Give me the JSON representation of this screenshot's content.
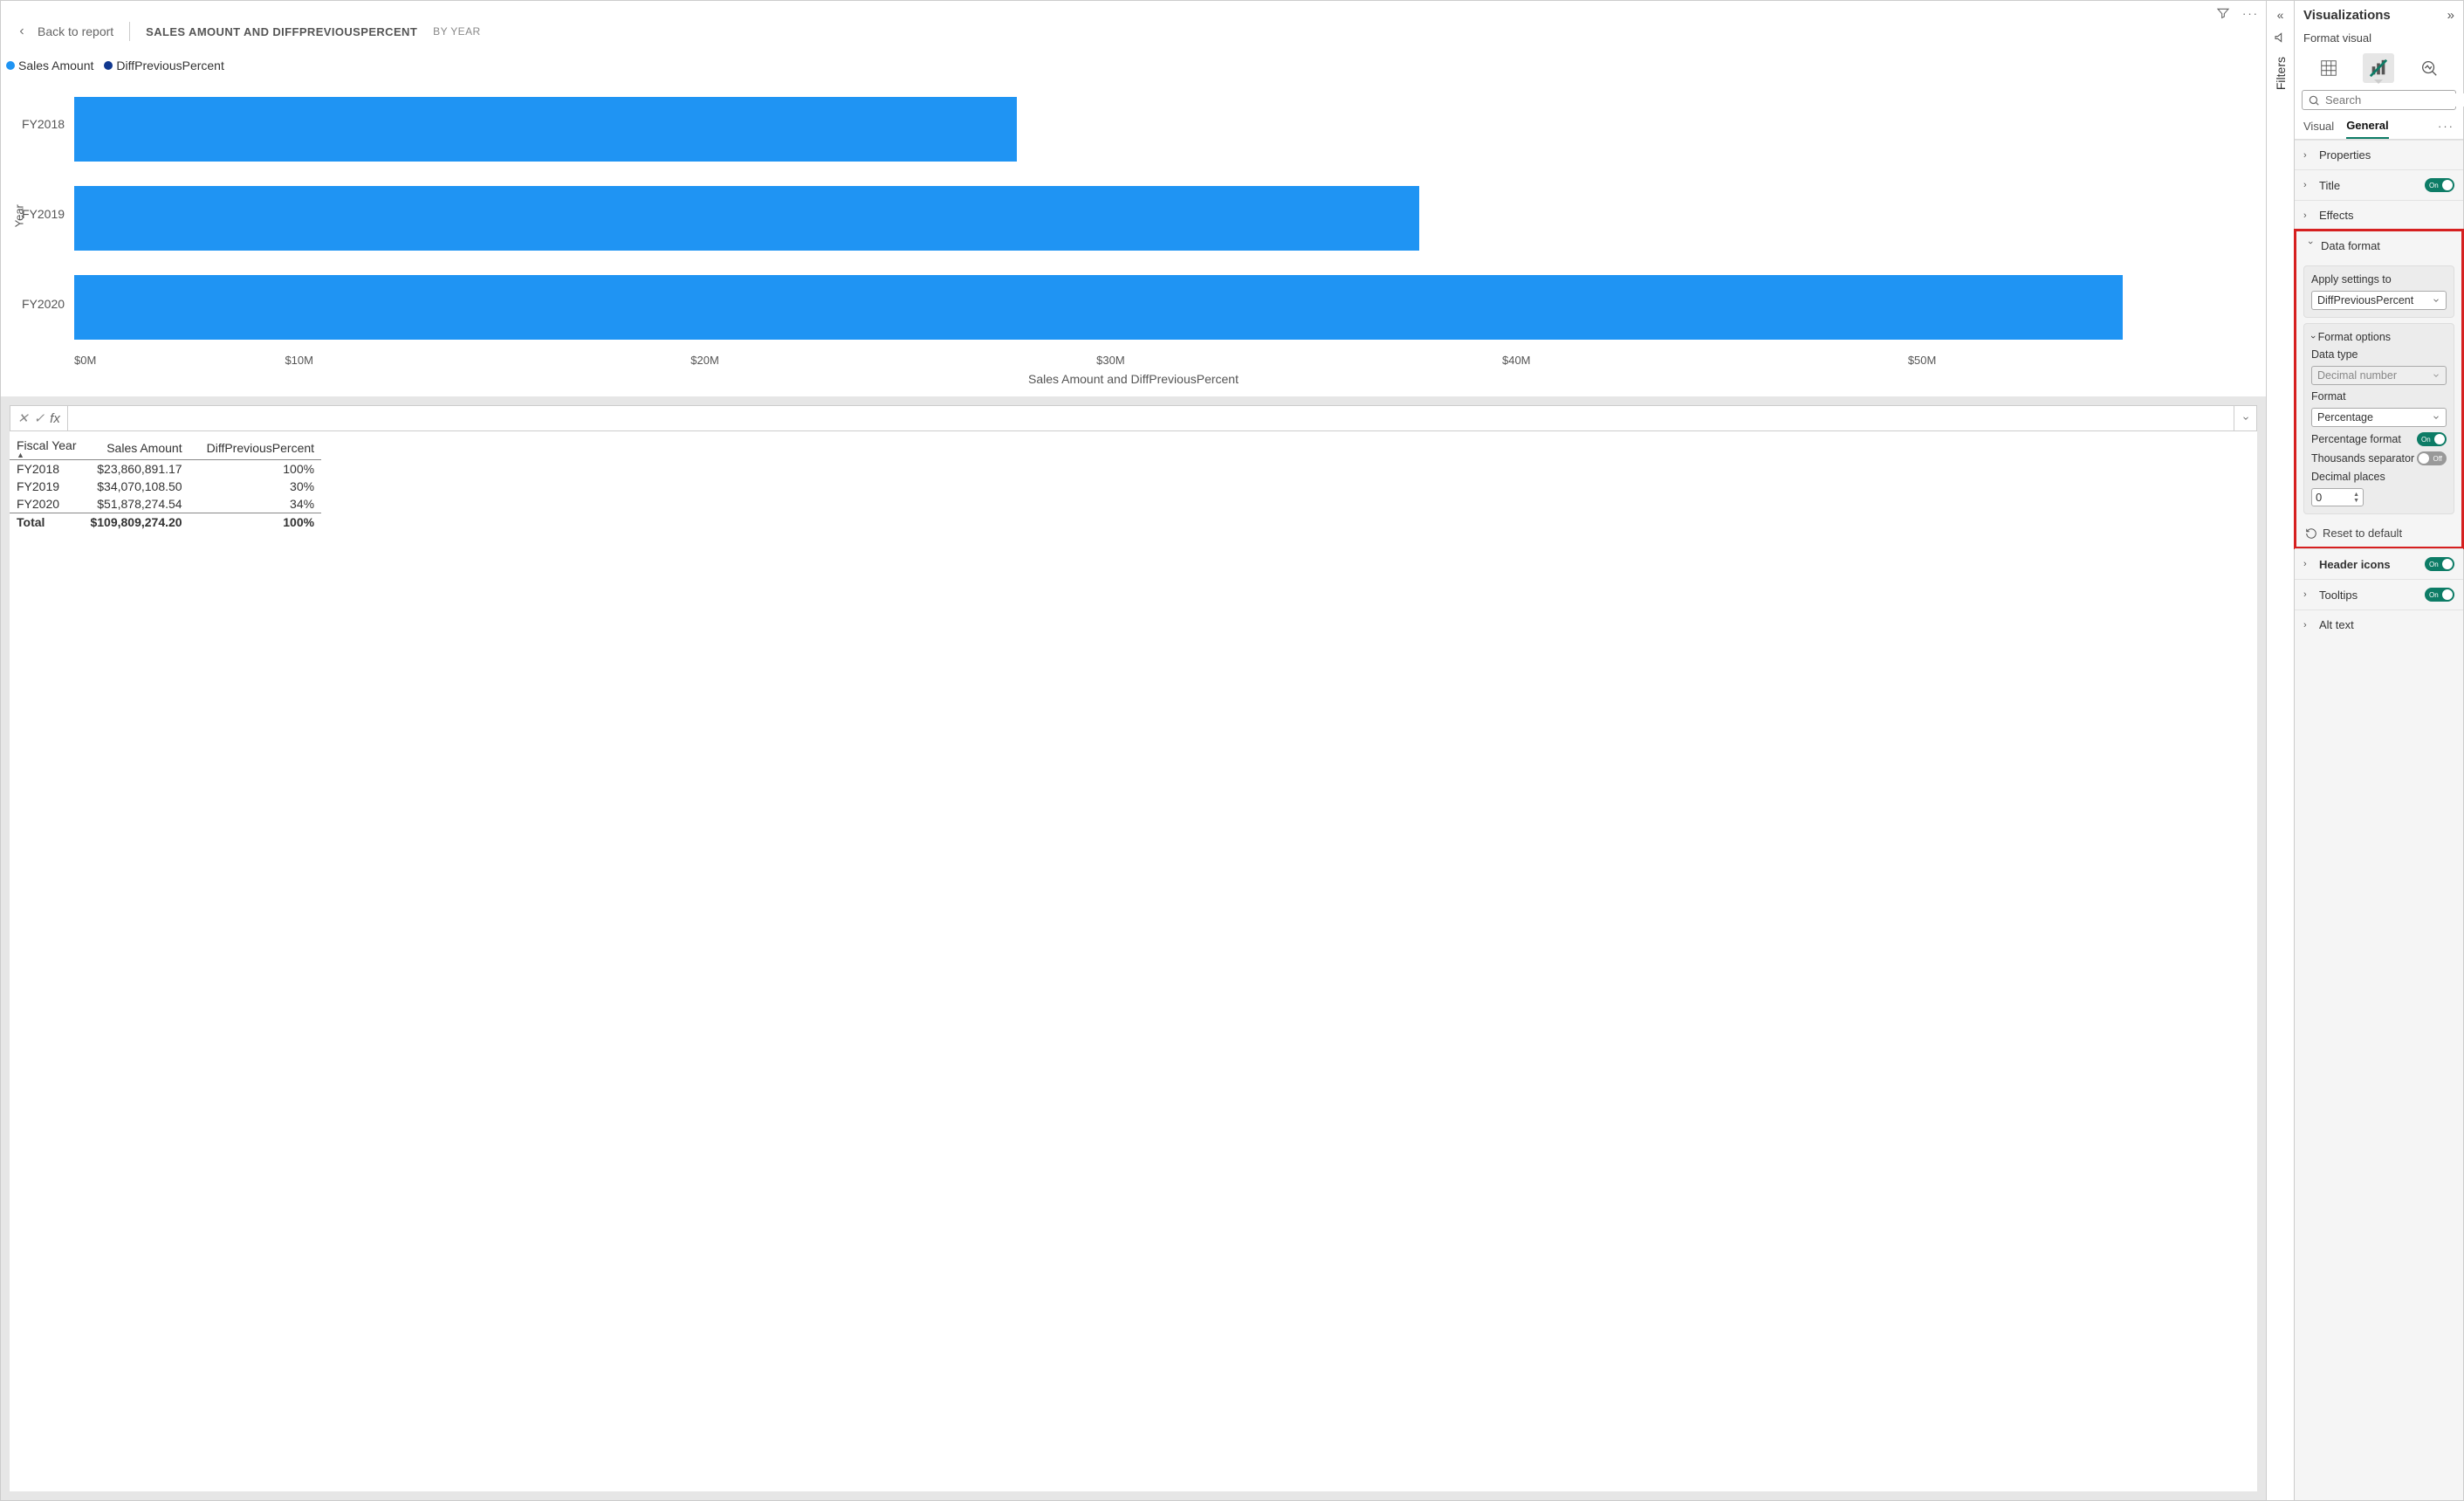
{
  "header": {
    "back_label": "Back to report",
    "title": "SALES AMOUNT AND DIFFPREVIOUSPERCENT",
    "subtitle": "BY YEAR"
  },
  "legend": {
    "items": [
      {
        "label": "Sales Amount",
        "color": "#1f94f3"
      },
      {
        "label": "DiffPreviousPercent",
        "color": "#11388f"
      }
    ]
  },
  "chart_data": {
    "type": "bar",
    "orientation": "horizontal",
    "title": "Sales Amount and DiffPreviousPercent",
    "y_axis_label": "Year",
    "x_axis_label": "Sales Amount and DiffPreviousPercent",
    "categories": [
      "FY2018",
      "FY2019",
      "FY2020"
    ],
    "series": [
      {
        "name": "Sales Amount",
        "color": "#1f94f3",
        "values": [
          23860891.17,
          34070108.5,
          51878274.54
        ]
      },
      {
        "name": "DiffPreviousPercent",
        "color": "#11388f",
        "values": [
          1.0,
          0.3,
          0.34
        ]
      }
    ],
    "x_ticks": [
      "$0M",
      "$10M",
      "$20M",
      "$30M",
      "$40M",
      "$50M"
    ],
    "xlim": [
      0,
      55000000
    ]
  },
  "table": {
    "columns": [
      "Fiscal Year",
      "Sales Amount",
      "DiffPreviousPercent"
    ],
    "rows": [
      {
        "fy": "FY2018",
        "amount": "$23,860,891.17",
        "pct": "100%"
      },
      {
        "fy": "FY2019",
        "amount": "$34,070,108.50",
        "pct": "30%"
      },
      {
        "fy": "FY2020",
        "amount": "$51,878,274.54",
        "pct": "34%"
      }
    ],
    "total": {
      "fy": "Total",
      "amount": "$109,809,274.20",
      "pct": "100%"
    }
  },
  "filters_rail": {
    "label": "Filters"
  },
  "viz": {
    "pane_title": "Visualizations",
    "subtitle": "Format visual",
    "search_placeholder": "Search",
    "tabs": {
      "visual": "Visual",
      "general": "General"
    },
    "sections_top": [
      {
        "label": "Properties",
        "toggle": null
      },
      {
        "label": "Title",
        "toggle": "On"
      },
      {
        "label": "Effects",
        "toggle": null
      }
    ],
    "data_format": {
      "label": "Data format",
      "apply_label": "Apply settings to",
      "apply_value": "DiffPreviousPercent",
      "format_options_label": "Format options",
      "data_type_label": "Data type",
      "data_type_value": "Decimal number",
      "format_label": "Format",
      "format_value": "Percentage",
      "pct_format_label": "Percentage format",
      "pct_format_toggle": "On",
      "thousands_label": "Thousands separator",
      "thousands_toggle": "Off",
      "decimal_label": "Decimal places",
      "decimal_value": "0",
      "reset_label": "Reset to default"
    },
    "sections_bottom": [
      {
        "label": "Header icons",
        "toggle": "On"
      },
      {
        "label": "Tooltips",
        "toggle": "On"
      },
      {
        "label": "Alt text",
        "toggle": null
      }
    ]
  }
}
